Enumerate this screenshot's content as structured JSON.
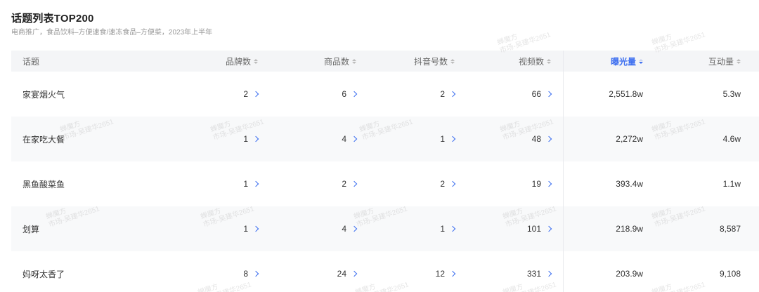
{
  "title": "话题列表TOP200",
  "subtitle": "电商推广，食品饮料–方便速食/速冻食品–方便菜，2023年上半年",
  "columns": {
    "topic": "话题",
    "brand": "品牌数",
    "goods": "商品数",
    "douyin": "抖音号数",
    "video": "视频数",
    "exposure": "曝光量",
    "interaction": "互动量"
  },
  "rows": [
    {
      "topic": "家宴烟火气",
      "brand": "2",
      "goods": "6",
      "douyin": "2",
      "video": "66",
      "exposure": "2,551.8w",
      "interaction": "5.3w"
    },
    {
      "topic": "在家吃大餐",
      "brand": "1",
      "goods": "4",
      "douyin": "1",
      "video": "48",
      "exposure": "2,272w",
      "interaction": "4.6w"
    },
    {
      "topic": "黑鱼酸菜鱼",
      "brand": "1",
      "goods": "2",
      "douyin": "2",
      "video": "19",
      "exposure": "393.4w",
      "interaction": "1.1w"
    },
    {
      "topic": "划算",
      "brand": "1",
      "goods": "4",
      "douyin": "1",
      "video": "101",
      "exposure": "218.9w",
      "interaction": "8,587"
    },
    {
      "topic": "妈呀太香了",
      "brand": "8",
      "goods": "24",
      "douyin": "12",
      "video": "331",
      "exposure": "203.9w",
      "interaction": "9,108"
    }
  ],
  "watermark": {
    "line1": "蝉魔方",
    "line2": "市场-吴建华2651"
  },
  "colors": {
    "accent": "#3c6ef0",
    "header_bg": "#f4f5f7",
    "alt_row_bg": "#f8f9fa"
  },
  "sort": {
    "active_column": "exposure",
    "direction": "desc"
  }
}
